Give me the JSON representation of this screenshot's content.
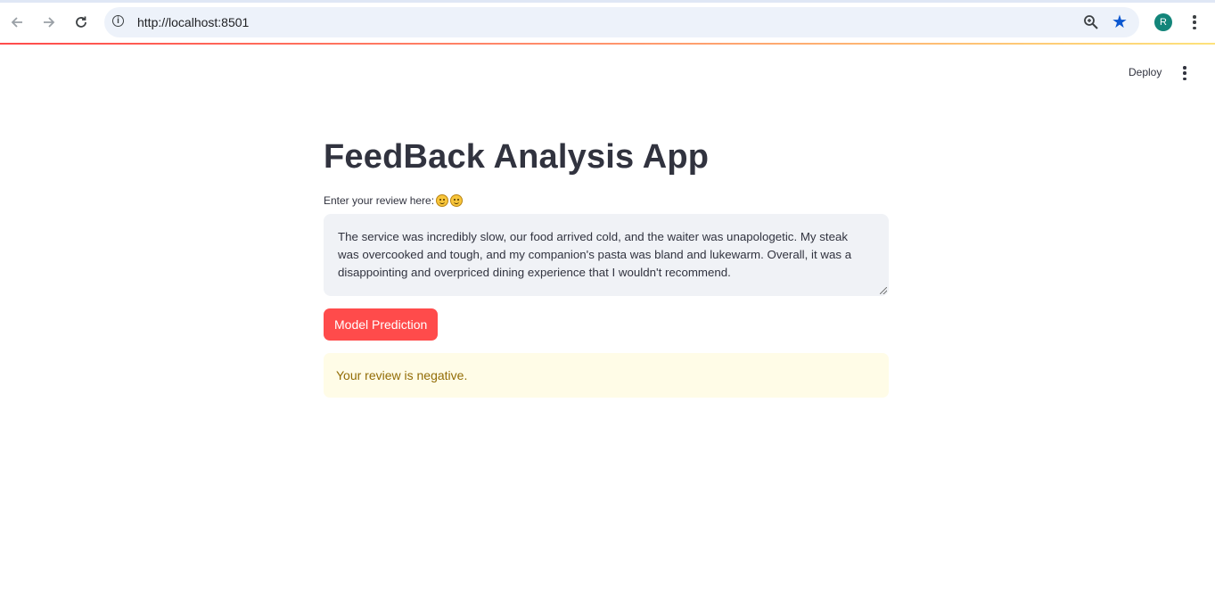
{
  "browser": {
    "url": "http://localhost:8501",
    "avatar_letter": "R",
    "icons": {
      "back": "back-arrow-icon",
      "forward": "forward-arrow-icon",
      "reload": "reload-icon",
      "info": "info-icon",
      "zoom": "zoom-icon",
      "bookmark": "star-icon",
      "menu": "kebab-menu-icon"
    }
  },
  "app_header": {
    "deploy_label": "Deploy"
  },
  "main": {
    "title": "FeedBack Analysis App",
    "input_label": "Enter your review here:",
    "review_text": "The service was incredibly slow, our food arrived cold, and the waiter was unapologetic.  My steak was overcooked and tough, and my companion's pasta was bland and lukewarm.  Overall, it was a disappointing and overpriced dining experience that I wouldn't recommend.",
    "predict_button": "Model Prediction",
    "result_text": "Your review is negative."
  },
  "colors": {
    "primary": "#ff4b4b",
    "text": "#31333f",
    "input_bg": "#f0f2f6",
    "warning_bg": "#fffce7",
    "warning_text": "#926c05",
    "bookmark_star": "#0b57d0",
    "avatar_bg": "#13857a"
  }
}
